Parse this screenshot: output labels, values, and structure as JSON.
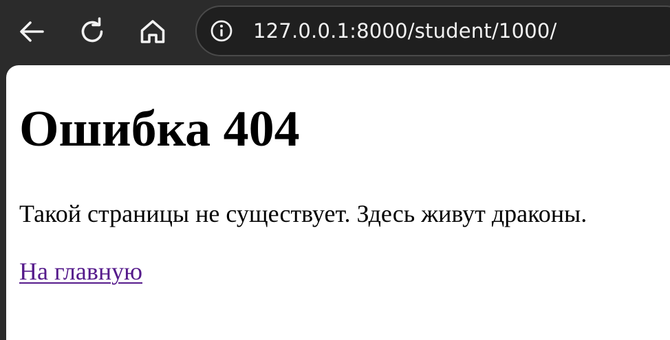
{
  "browser": {
    "url": "127.0.0.1:8000/student/1000/",
    "icons": {
      "back": "back-arrow-icon",
      "reload": "reload-icon",
      "home": "home-icon",
      "info": "info-icon"
    }
  },
  "page": {
    "title": "Ошибка 404",
    "message": "Такой страницы не существует. Здесь живут драконы.",
    "home_link": "На главную",
    "link_color": "#551a8b"
  }
}
